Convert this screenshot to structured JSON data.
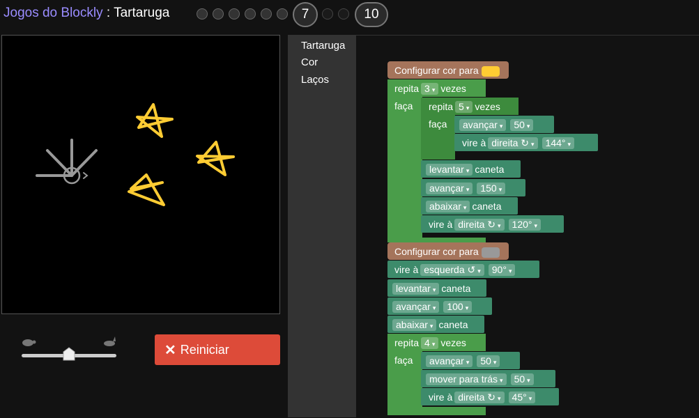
{
  "header": {
    "games_link": "Jogos do Blockly",
    "separator": " : ",
    "page": "Tartaruga",
    "current_level": "7",
    "last_level": "10"
  },
  "controls": {
    "reset_label": "Reiniciar",
    "reset_icon": "close-icon",
    "speed_slow_icon": "turtle-icon",
    "speed_fast_icon": "rabbit-icon",
    "speed_level": 0.5
  },
  "toolbox": [
    "Tartaruga",
    "Cor",
    "Laços"
  ],
  "colors": {
    "motion": "#5b80a5",
    "pen": "#5ba55b",
    "loop": "#4a9d4a",
    "color_block": "#a5745b",
    "star": "#ffcc33",
    "reset": "#dd4b39"
  },
  "blocks": {
    "set_color_1": {
      "label": "Configurar cor para",
      "color": "#ffcc33"
    },
    "repeat_1": {
      "a": "repita",
      "n": "3",
      "b": "vezes",
      "do": "faça"
    },
    "repeat_2": {
      "a": "repita",
      "n": "5",
      "b": "vezes",
      "do": "faça"
    },
    "move_1": {
      "op": "avançar",
      "v": "50"
    },
    "turn_1": {
      "a": "vire à",
      "dir": "direita ↻",
      "v": "144°"
    },
    "pen_up_1": {
      "op": "levantar",
      "b": "caneta"
    },
    "move_2": {
      "op": "avançar",
      "v": "150"
    },
    "pen_down_1": {
      "op": "abaixar",
      "b": "caneta"
    },
    "turn_2": {
      "a": "vire à",
      "dir": "direita ↻",
      "v": "120°"
    },
    "set_color_2": {
      "label": "Configurar cor para",
      "color": "#999999"
    },
    "turn_3": {
      "a": "vire à",
      "dir": "esquerda ↺",
      "v": "90°"
    },
    "pen_up_2": {
      "op": "levantar",
      "b": "caneta"
    },
    "move_3": {
      "op": "avançar",
      "v": "100"
    },
    "pen_down_2": {
      "op": "abaixar",
      "b": "caneta"
    },
    "repeat_3": {
      "a": "repita",
      "n": "4",
      "b": "vezes",
      "do": "faça"
    },
    "move_4": {
      "op": "avançar",
      "v": "50"
    },
    "move_back": {
      "op": "mover para trás",
      "v": "50"
    },
    "turn_4": {
      "a": "vire à",
      "dir": "direita ↻",
      "v": "45°"
    }
  }
}
